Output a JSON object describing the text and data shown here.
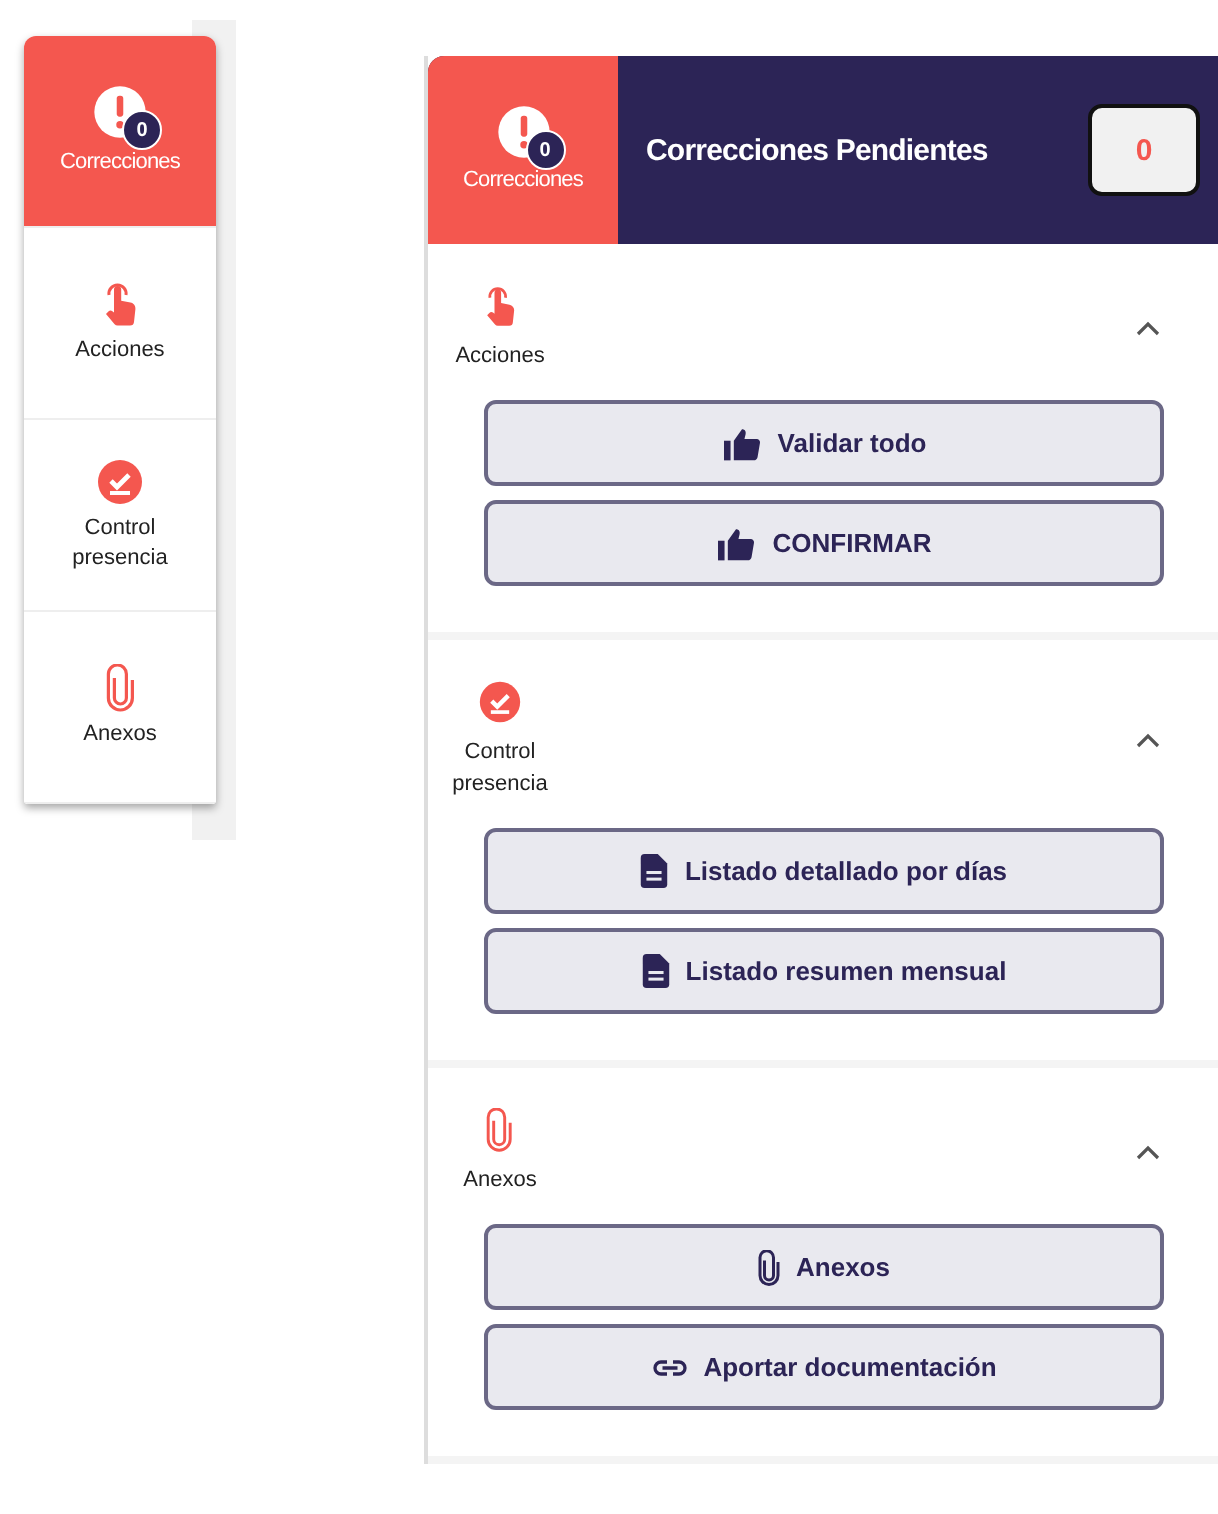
{
  "rail": {
    "items": [
      {
        "kind": "alert",
        "label": "Correcciones",
        "badge": "0",
        "selected": true
      },
      {
        "kind": "hand",
        "label": "Acciones",
        "selected": false
      },
      {
        "kind": "check",
        "label": "Control presencia",
        "selected": false
      },
      {
        "kind": "clip",
        "label": "Anexos",
        "selected": false
      }
    ]
  },
  "panel": {
    "header": {
      "tab": {
        "kind": "alert",
        "label": "Correcciones",
        "badge": "0"
      },
      "title": "Correcciones Pendientes",
      "count": "0"
    },
    "sections": [
      {
        "kind": "hand",
        "label": "Acciones",
        "expanded": true,
        "buttons": [
          {
            "kind": "thumb",
            "label": "Validar todo"
          },
          {
            "kind": "thumb",
            "label": "CONFIRMAR"
          }
        ]
      },
      {
        "kind": "check",
        "label": "Control presencia",
        "expanded": true,
        "buttons": [
          {
            "kind": "doc",
            "label": "Listado detallado por días"
          },
          {
            "kind": "doc",
            "label": "Listado resumen mensual"
          }
        ]
      },
      {
        "kind": "clip",
        "label": "Anexos",
        "expanded": true,
        "buttons": [
          {
            "kind": "clip",
            "label": "Anexos"
          },
          {
            "kind": "link",
            "label": "Aportar documentación"
          }
        ]
      }
    ]
  }
}
